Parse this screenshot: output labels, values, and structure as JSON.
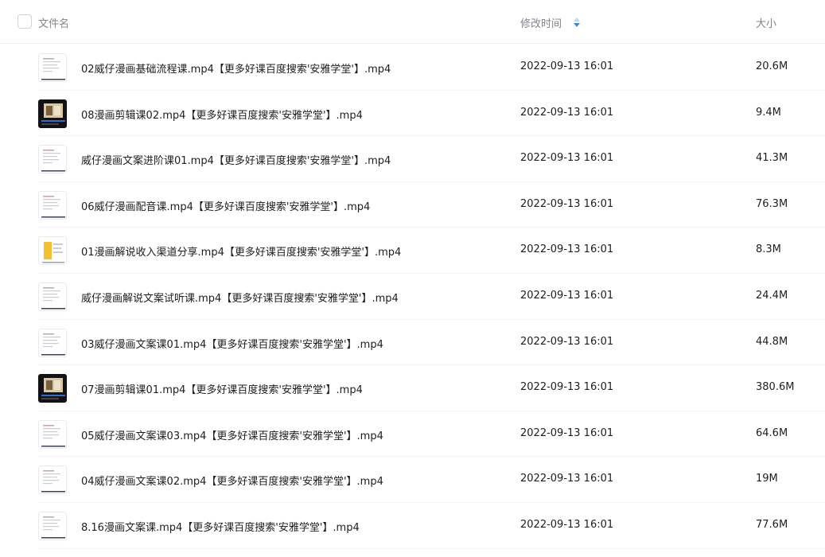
{
  "header": {
    "name_label": "文件名",
    "mtime_label": "修改时间",
    "size_label": "大小",
    "sort_icon": "sort-desc-icon"
  },
  "files": [
    {
      "name": "02威仔漫画基础流程课.mp4【更多好课百度搜索'安雅学堂'】.mp4",
      "mtime": "2022-09-13 16:01",
      "size": "20.6M",
      "thumb": "doc"
    },
    {
      "name": "08漫画剪辑课02.mp4【更多好课百度搜索'安雅学堂'】.mp4",
      "mtime": "2022-09-13 16:01",
      "size": "9.4M",
      "thumb": "dark"
    },
    {
      "name": "威仔漫画文案进阶课01.mp4【更多好课百度搜索'安雅学堂'】.mp4",
      "mtime": "2022-09-13 16:01",
      "size": "41.3M",
      "thumb": "doc"
    },
    {
      "name": "06威仔漫画配音课.mp4【更多好课百度搜索'安雅学堂'】.mp4",
      "mtime": "2022-09-13 16:01",
      "size": "76.3M",
      "thumb": "doc"
    },
    {
      "name": "01漫画解说收入渠道分享.mp4【更多好课百度搜索'安雅学堂'】.mp4",
      "mtime": "2022-09-13 16:01",
      "size": "8.3M",
      "thumb": "yellow"
    },
    {
      "name": "威仔漫画解说文案试听课.mp4【更多好课百度搜索'安雅学堂'】.mp4",
      "mtime": "2022-09-13 16:01",
      "size": "24.4M",
      "thumb": "doc"
    },
    {
      "name": "03威仔漫画文案课01.mp4【更多好课百度搜索'安雅学堂'】.mp4",
      "mtime": "2022-09-13 16:01",
      "size": "44.8M",
      "thumb": "doc"
    },
    {
      "name": "07漫画剪辑课01.mp4【更多好课百度搜索'安雅学堂'】.mp4",
      "mtime": "2022-09-13 16:01",
      "size": "380.6M",
      "thumb": "dark"
    },
    {
      "name": "05威仔漫画文案课03.mp4【更多好课百度搜索'安雅学堂'】.mp4",
      "mtime": "2022-09-13 16:01",
      "size": "64.6M",
      "thumb": "doc"
    },
    {
      "name": "04威仔漫画文案课02.mp4【更多好课百度搜索'安雅学堂'】.mp4",
      "mtime": "2022-09-13 16:01",
      "size": "19M",
      "thumb": "doc"
    },
    {
      "name": "8.16漫画文案课.mp4【更多好课百度搜索'安雅学堂'】.mp4",
      "mtime": "2022-09-13 16:01",
      "size": "77.6M",
      "thumb": "doc"
    }
  ],
  "colors": {
    "sort_up": "#b9d8ff",
    "sort_down": "#2e8bff",
    "header_text": "#7f848c",
    "row_divider": "#f2f3f5"
  }
}
